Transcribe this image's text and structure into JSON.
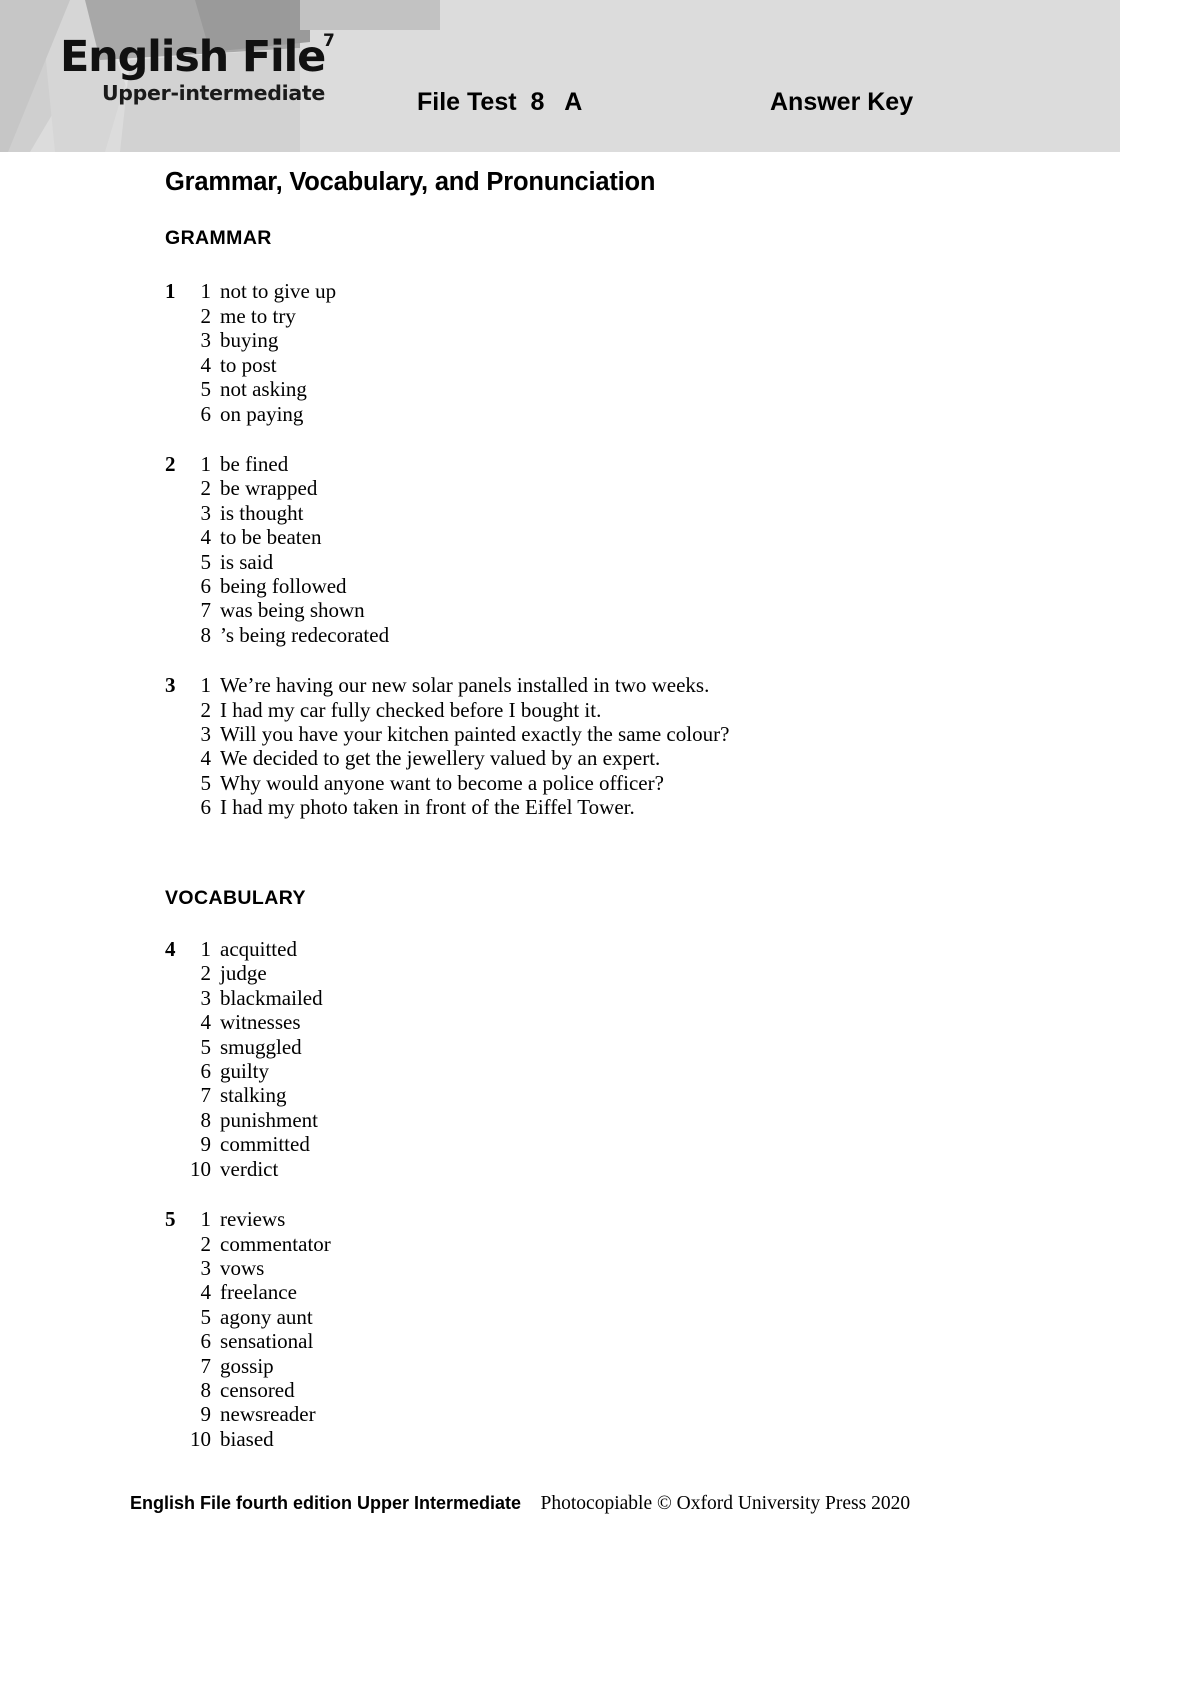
{
  "header": {
    "logo_title": "English File",
    "logo_superscript": "7",
    "logo_subtitle": "Upper-intermediate",
    "test_label": "File Test  8   A",
    "answer_key_label": "Answer Key",
    "band_color": "#dcdcdc"
  },
  "page_title": "Grammar, Vocabulary, and Pronunciation",
  "sections": [
    {
      "heading": "GRAMMAR",
      "exercises": [
        {
          "number": "1",
          "items": [
            {
              "idx": "1",
              "answer": "not to give up"
            },
            {
              "idx": "2",
              "answer": "me to try"
            },
            {
              "idx": "3",
              "answer": "buying"
            },
            {
              "idx": "4",
              "answer": "to post"
            },
            {
              "idx": "5",
              "answer": "not asking"
            },
            {
              "idx": "6",
              "answer": "on paying"
            }
          ]
        },
        {
          "number": "2",
          "items": [
            {
              "idx": "1",
              "answer": "be fined"
            },
            {
              "idx": "2",
              "answer": "be wrapped"
            },
            {
              "idx": "3",
              "answer": "is thought"
            },
            {
              "idx": "4",
              "answer": "to be beaten"
            },
            {
              "idx": "5",
              "answer": "is said"
            },
            {
              "idx": "6",
              "answer": "being followed"
            },
            {
              "idx": "7",
              "answer": "was being shown"
            },
            {
              "idx": "8",
              "answer": "’s being redecorated"
            }
          ]
        },
        {
          "number": "3",
          "items": [
            {
              "idx": "1",
              "answer": "We’re having our new solar panels installed in two weeks."
            },
            {
              "idx": "2",
              "answer": "I had my car fully checked before I bought it."
            },
            {
              "idx": "3",
              "answer": "Will you have your kitchen painted exactly the same colour?"
            },
            {
              "idx": "4",
              "answer": "We decided to get the jewellery valued by an expert."
            },
            {
              "idx": "5",
              "answer": "Why would anyone want to become a police officer?"
            },
            {
              "idx": "6",
              "answer": "I had my photo taken in front of the Eiffel Tower."
            }
          ]
        }
      ]
    },
    {
      "heading": "VOCABULARY",
      "exercises": [
        {
          "number": "4",
          "items": [
            {
              "idx": "1",
              "answer": "acquitted"
            },
            {
              "idx": "2",
              "answer": "judge"
            },
            {
              "idx": "3",
              "answer": "blackmailed"
            },
            {
              "idx": "4",
              "answer": "witnesses"
            },
            {
              "idx": "5",
              "answer": "smuggled"
            },
            {
              "idx": "6",
              "answer": "guilty"
            },
            {
              "idx": "7",
              "answer": "stalking"
            },
            {
              "idx": "8",
              "answer": "punishment"
            },
            {
              "idx": "9",
              "answer": "committed"
            },
            {
              "idx": "10",
              "answer": "verdict"
            }
          ]
        },
        {
          "number": "5",
          "items": [
            {
              "idx": "1",
              "answer": "reviews"
            },
            {
              "idx": "2",
              "answer": "commentator"
            },
            {
              "idx": "3",
              "answer": "vows"
            },
            {
              "idx": "4",
              "answer": "freelance"
            },
            {
              "idx": "5",
              "answer": "agony aunt"
            },
            {
              "idx": "6",
              "answer": "sensational"
            },
            {
              "idx": "7",
              "answer": "gossip"
            },
            {
              "idx": "8",
              "answer": "censored"
            },
            {
              "idx": "9",
              "answer": "newsreader"
            },
            {
              "idx": "10",
              "answer": "biased"
            }
          ]
        }
      ]
    }
  ],
  "footer": {
    "bold_text": "English File fourth edition Upper Intermediate",
    "normal_text": "    Photocopiable © Oxford University Press 2020"
  }
}
